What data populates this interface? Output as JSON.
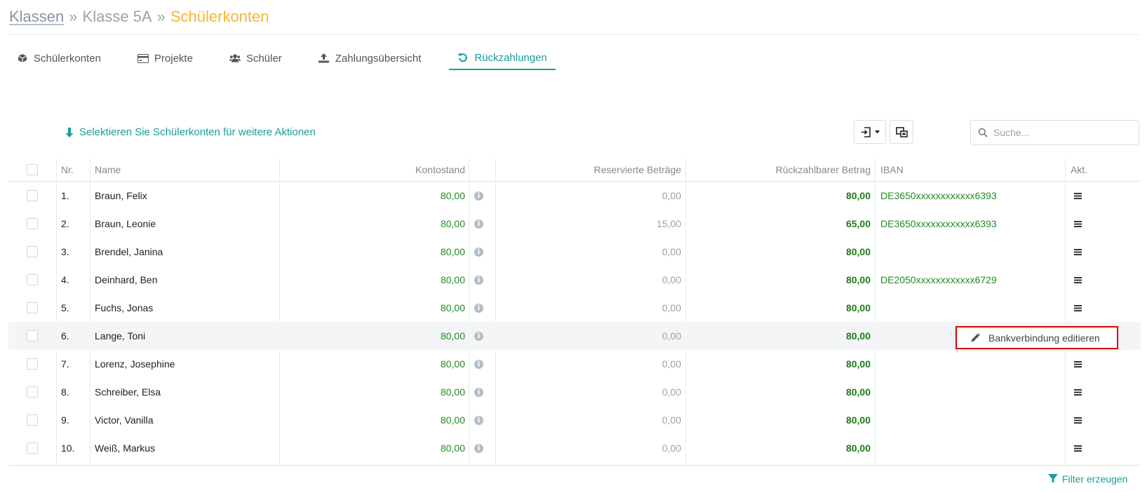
{
  "breadcrumb": {
    "root": "Klassen",
    "sep1": "»",
    "mid": "Klasse 5A",
    "sep2": "»",
    "current": "Schülerkonten"
  },
  "tabs": [
    {
      "label": "Schülerkonten",
      "icon": "box-icon"
    },
    {
      "label": "Projekte",
      "icon": "credit-card-icon"
    },
    {
      "label": "Schüler",
      "icon": "users-icon"
    },
    {
      "label": "Zahlungsübersicht",
      "icon": "upload-icon"
    },
    {
      "label": "Rückzahlungen",
      "icon": "undo-icon",
      "active": true
    }
  ],
  "toolbar": {
    "select_hint": "Selektieren Sie Schülerkonten für weitere Aktionen",
    "search_placeholder": "Suche..."
  },
  "table": {
    "headers": {
      "nr": "Nr.",
      "name": "Name",
      "kontostand": "Kontostand",
      "reserviert": "Reservierte Beträge",
      "rueckzahlbar": "Rückzahlbarer Betrag",
      "iban": "IBAN",
      "akt": "Akt."
    },
    "rows": [
      {
        "nr": "1.",
        "name": "Braun, Felix",
        "kontostand": "80,00",
        "reserviert": "0,00",
        "rueckzahlbar": "80,00",
        "iban": "DE3650xxxxxxxxxxxx6393"
      },
      {
        "nr": "2.",
        "name": "Braun, Leonie",
        "kontostand": "80,00",
        "reserviert": "15,00",
        "rueckzahlbar": "65,00",
        "iban": "DE3650xxxxxxxxxxxx6393"
      },
      {
        "nr": "3.",
        "name": "Brendel, Janina",
        "kontostand": "80,00",
        "reserviert": "0,00",
        "rueckzahlbar": "80,00",
        "iban": ""
      },
      {
        "nr": "4.",
        "name": "Deinhard, Ben",
        "kontostand": "80,00",
        "reserviert": "0,00",
        "rueckzahlbar": "80,00",
        "iban": "DE2050xxxxxxxxxxxx6729"
      },
      {
        "nr": "5.",
        "name": "Fuchs, Jonas",
        "kontostand": "80,00",
        "reserviert": "0,00",
        "rueckzahlbar": "80,00",
        "iban": ""
      },
      {
        "nr": "6.",
        "name": "Lange, Toni",
        "kontostand": "80,00",
        "reserviert": "0,00",
        "rueckzahlbar": "80,00",
        "iban": "",
        "highlight": true
      },
      {
        "nr": "7.",
        "name": "Lorenz, Josephine",
        "kontostand": "80,00",
        "reserviert": "0,00",
        "rueckzahlbar": "80,00",
        "iban": ""
      },
      {
        "nr": "8.",
        "name": "Schreiber, Elsa",
        "kontostand": "80,00",
        "reserviert": "0,00",
        "rueckzahlbar": "80,00",
        "iban": ""
      },
      {
        "nr": "9.",
        "name": "Victor, Vanilla",
        "kontostand": "80,00",
        "reserviert": "0,00",
        "rueckzahlbar": "80,00",
        "iban": ""
      },
      {
        "nr": "10.",
        "name": "Weiß, Markus",
        "kontostand": "80,00",
        "reserviert": "0,00",
        "rueckzahlbar": "80,00",
        "iban": ""
      }
    ]
  },
  "dropdown": {
    "item_label": "Bankverbindung editieren",
    "icon": "pencil-icon"
  },
  "footer": {
    "filter_label": "Filter erzeugen",
    "icon": "filter-icon"
  },
  "colors": {
    "accent": "#1a9c9c",
    "breadcrumb_current": "#f5b731",
    "amount_green": "#228b22",
    "highlight_border": "#e00000"
  }
}
